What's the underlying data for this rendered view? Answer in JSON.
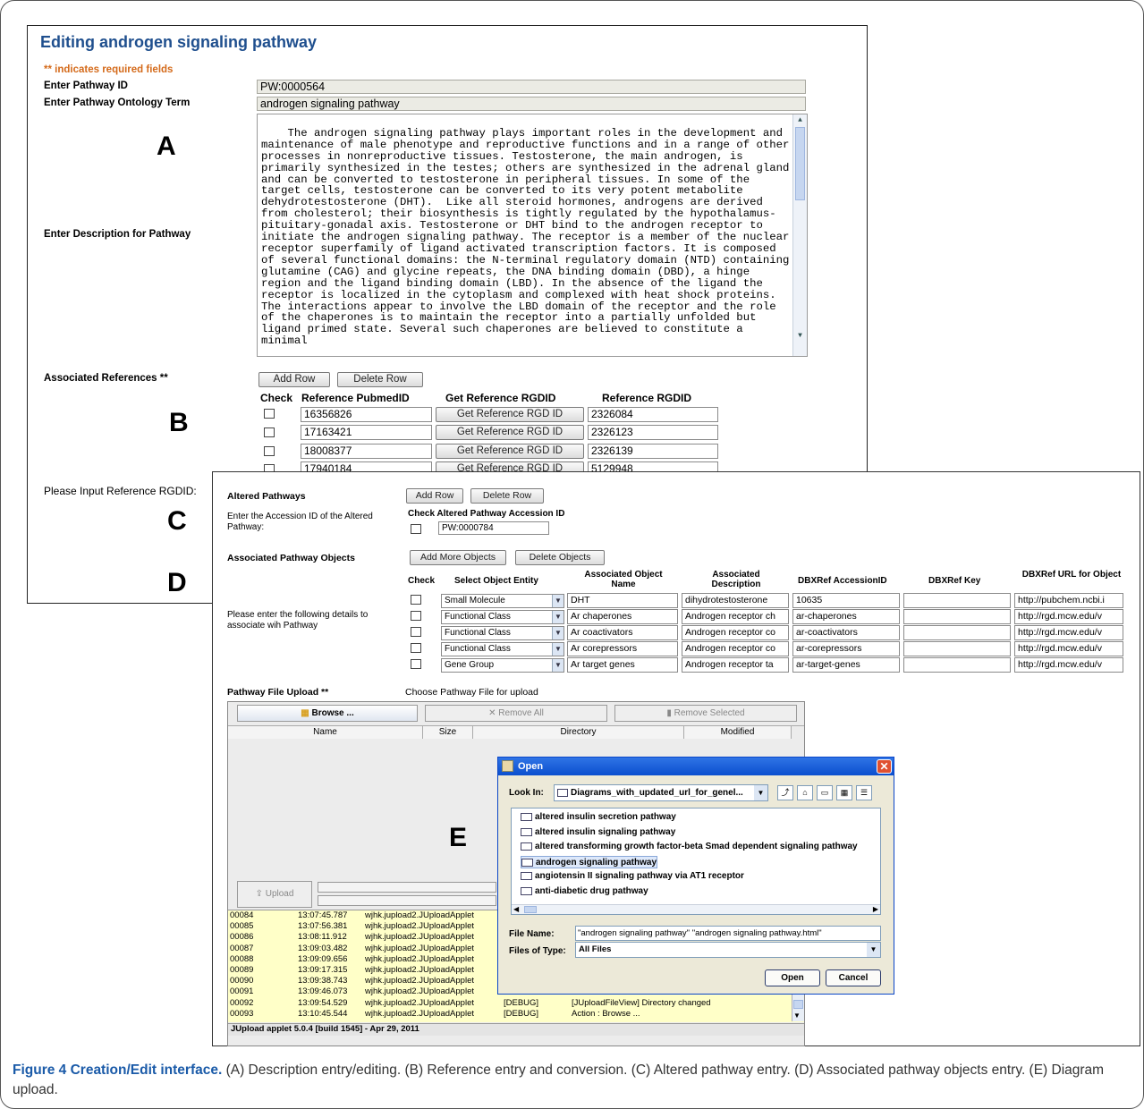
{
  "panel1": {
    "title": "Editing androgen signaling pathway",
    "required_note": "** indicates required fields",
    "pathway_id_label": "Enter Pathway ID",
    "pathway_id_value": "PW:0000564",
    "term_label": "Enter Pathway Ontology Term",
    "term_value": "androgen signaling pathway",
    "desc_label": "Enter Description for Pathway",
    "description": "The androgen signaling pathway plays important roles in the development and maintenance of male phenotype and reproductive functions and in a range of other processes in nonreproductive tissues. Testosterone, the main androgen, is primarily synthesized in the testes; others are synthesized in the adrenal gland and can be converted to testosterone in peripheral tissues. In some of the target cells, testosterone can be converted to its very potent metabolite dehydrotestosterone (DHT).  Like all steroid hormones, androgens are derived from cholesterol; their biosynthesis is tightly regulated by the hypothalamus-pituitary-gonadal axis. Testosterone or DHT bind to the androgen receptor to initiate the androgen signaling pathway. The receptor is a member of the nuclear receptor superfamily of ligand activated transcription factors. It is composed of several functional domains: the N-terminal regulatory domain (NTD) containing glutamine (CAG) and glycine repeats, the DNA binding domain (DBD), a hinge region and the ligand binding domain (LBD). In the absence of the ligand the receptor is localized in the cytoplasm and complexed with heat shock proteins. The interactions appear to involve the LBD domain of the receptor and the role of the chaperones is to maintain the receptor into a partially unfolded but ligand primed state. Several such chaperones are believed to constitute a minimal",
    "refs_label": "Associated References **",
    "add_row": "Add Row",
    "delete_row": "Delete Row",
    "col_check": "Check",
    "col_pubmed": "Reference PubmedID",
    "col_get": "Get Reference RGDID",
    "col_rgdid": "Reference RGDID",
    "get_btn": "Get Reference RGD ID",
    "refs": [
      {
        "pubmed": "16356826",
        "rgdid": "2326084"
      },
      {
        "pubmed": "17163421",
        "rgdid": "2326123"
      },
      {
        "pubmed": "18008377",
        "rgdid": "2326139"
      },
      {
        "pubmed": "17940184",
        "rgdid": "5129948"
      }
    ],
    "input_rgdid_label": "Please Input Reference RGDID:"
  },
  "letters": {
    "a": "A",
    "b": "B",
    "c": "C",
    "d": "D",
    "e": "E"
  },
  "panel2": {
    "altered_label": "Altered Pathways",
    "add_row": "Add Row",
    "delete_row": "Delete Row",
    "accession_prompt": "Enter the Accession ID of the Altered Pathway:",
    "altered_col": "Check Altered Pathway Accession ID",
    "altered_value": "PW:0000784",
    "objects_label": "Associated Pathway Objects",
    "add_more": "Add More Objects",
    "delete_objects": "Delete Objects",
    "objects_prompt": "Please enter the following details to associate wih Pathway",
    "cols": {
      "check": "Check",
      "entity": "Select Object Entity",
      "name": "Associated Object Name",
      "desc": "Associated Description",
      "acc": "DBXRef AccessionID",
      "key": "DBXRef Key",
      "url": "DBXRef URL for Object"
    },
    "objects": [
      {
        "entity": "Small Molecule",
        "name": "DHT",
        "desc": "dihydrotestosterone",
        "acc": "10635",
        "url": "http://pubchem.ncbi.i"
      },
      {
        "entity": "Functional Class",
        "name": "Ar chaperones",
        "desc": "Androgen receptor ch",
        "acc": "ar-chaperones",
        "url": "http://rgd.mcw.edu/v"
      },
      {
        "entity": "Functional Class",
        "name": "Ar coactivators",
        "desc": "Androgen receptor co",
        "acc": "ar-coactivators",
        "url": "http://rgd.mcw.edu/v"
      },
      {
        "entity": "Functional Class",
        "name": "Ar corepressors",
        "desc": "Androgen receptor co",
        "acc": "ar-corepressors",
        "url": "http://rgd.mcw.edu/v"
      },
      {
        "entity": "Gene Group",
        "name": "Ar target genes",
        "desc": "Androgen receptor ta",
        "acc": "ar-target-genes",
        "url": "http://rgd.mcw.edu/v"
      }
    ],
    "upload_label": "Pathway File Upload **",
    "upload_prompt": "Choose Pathway File for upload"
  },
  "jupload": {
    "browse": "Browse ...",
    "remove_all": "Remove All",
    "remove_selected": "Remove Selected",
    "col_name": "Name",
    "col_size": "Size",
    "col_directory": "Directory",
    "col_modified": "Modified",
    "upload": "Upload",
    "log": [
      {
        "id": "00084",
        "time": "13:07:45.787",
        "cls": "wjhk.jupload2.JUploadApplet",
        "lvl": "",
        "msg": ""
      },
      {
        "id": "00085",
        "time": "13:07:56.381",
        "cls": "wjhk.jupload2.JUploadApplet",
        "lvl": "",
        "msg": ""
      },
      {
        "id": "00086",
        "time": "13:08:11.912",
        "cls": "wjhk.jupload2.JUploadApplet",
        "lvl": "",
        "msg": ""
      },
      {
        "id": "00087",
        "time": "13:09:03.482",
        "cls": "wjhk.jupload2.JUploadApplet",
        "lvl": "",
        "msg": ""
      },
      {
        "id": "00088",
        "time": "13:09:09.656",
        "cls": "wjhk.jupload2.JUploadApplet",
        "lvl": "",
        "msg": ""
      },
      {
        "id": "00089",
        "time": "13:09:17.315",
        "cls": "wjhk.jupload2.JUploadApplet",
        "lvl": "",
        "msg": ""
      },
      {
        "id": "00090",
        "time": "13:09:38.743",
        "cls": "wjhk.jupload2.JUploadApplet",
        "lvl": "",
        "msg": ""
      },
      {
        "id": "00091",
        "time": "13:09:46.073",
        "cls": "wjhk.jupload2.JUploadApplet",
        "lvl": "",
        "msg": ""
      },
      {
        "id": "00092",
        "time": "13:09:54.529",
        "cls": "wjhk.jupload2.JUploadApplet",
        "lvl": "[DEBUG]",
        "msg": "[JUploadFileView] Directory changed"
      },
      {
        "id": "00093",
        "time": "13:10:45.544",
        "cls": "wjhk.jupload2.JUploadApplet",
        "lvl": "[DEBUG]",
        "msg": "Action : Browse ..."
      }
    ],
    "status": "JUpload applet 5.0.4 [build 1545] - Apr 29, 2011"
  },
  "dialog": {
    "title": "Open",
    "look_in_label": "Look In:",
    "look_in_value": "Diagrams_with_updated_url_for_genel...",
    "items": [
      "altered insulin secretion pathway",
      "altered insulin signaling pathway",
      "altered transforming growth factor-beta Smad dependent signaling pathway",
      "androgen signaling pathway",
      "angiotensin II signaling pathway via AT1 receptor",
      "anti-diabetic drug pathway"
    ],
    "file_name_label": "File Name:",
    "file_name_value": "\"androgen signaling pathway\" \"androgen signaling pathway.html\"",
    "file_type_label": "Files of Type:",
    "file_type_value": "All Files",
    "open": "Open",
    "cancel": "Cancel"
  },
  "caption": {
    "bold": "Figure 4 Creation/Edit interface.",
    "text": " (A) Description entry/editing. (B) Reference entry and conversion. (C) Altered pathway entry. (D) Associated pathway objects entry. (E) Diagram upload."
  }
}
